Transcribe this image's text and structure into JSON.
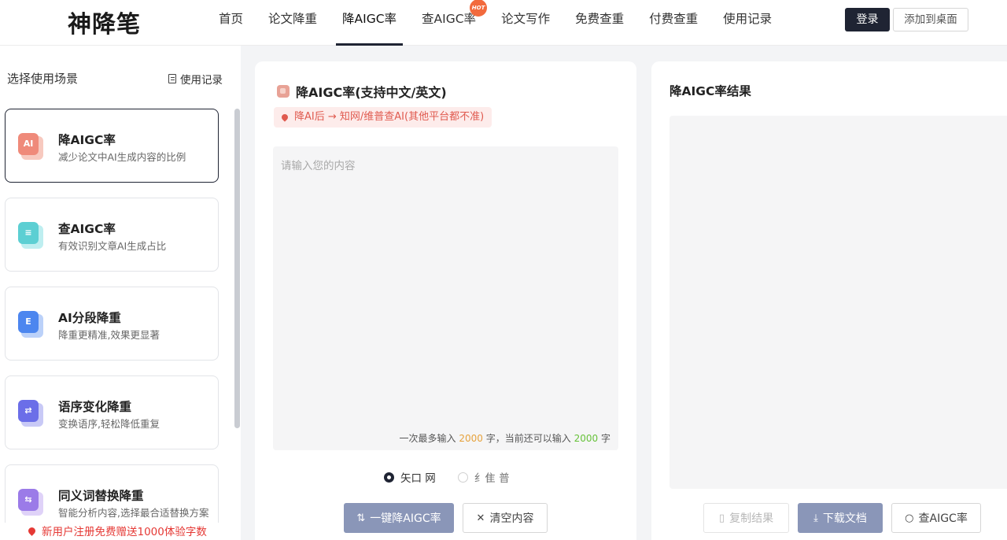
{
  "header": {
    "logo": "神降笔",
    "nav": [
      {
        "label": "首页",
        "active": false
      },
      {
        "label": "论文降重",
        "active": false
      },
      {
        "label": "降AIGC率",
        "active": true
      },
      {
        "label": "查AIGC率",
        "active": false,
        "badge": "HOT"
      },
      {
        "label": "论文写作",
        "active": false
      },
      {
        "label": "免费查重",
        "active": false
      },
      {
        "label": "付费查重",
        "active": false
      },
      {
        "label": "使用记录",
        "active": false
      }
    ],
    "login": "登录",
    "add_desktop": "添加到桌面"
  },
  "sidebar": {
    "title": "选择使用场景",
    "record_link": "使用记录",
    "cards": [
      {
        "title": "降AIGC率",
        "desc": "减少论文中AI生成内容的比例",
        "icon": "ai-reduce-icon",
        "color": "#ef8a7a",
        "active": true
      },
      {
        "title": "查AIGC率",
        "desc": "有效识别文章AI生成占比",
        "icon": "ai-detect-icon",
        "color": "#5ccfd3",
        "active": false
      },
      {
        "title": "AI分段降重",
        "desc": "降重更精准,效果更显著",
        "icon": "paragraph-icon",
        "color": "#4c86ef",
        "active": false
      },
      {
        "title": "语序变化降重",
        "desc": "变换语序,轻松降低重复",
        "icon": "reorder-icon",
        "color": "#6b6ee8",
        "active": false
      },
      {
        "title": "同义词替换降重",
        "desc": "智能分析内容,选择最合适替换方案",
        "icon": "synonym-icon",
        "color": "#9b7be8",
        "active": false
      }
    ],
    "promo": "新用户注册免费赠送1000体验字数"
  },
  "input_panel": {
    "title": "降AIGC率(支持中文/英文)",
    "tip": "降AI后 → 知网/维普查AI(其他平台都不准)",
    "placeholder": "请输入您的内容",
    "counter_prefix": "一次最多输入",
    "max_chars": "2000",
    "counter_mid": "字，当前还可以输入",
    "remaining_chars": "2000",
    "counter_suffix": "字",
    "radio_options": [
      {
        "label": "矢口 网",
        "checked": true
      },
      {
        "label": "纟隹 普",
        "checked": false
      }
    ],
    "submit_button": "一键降AIGC率",
    "clear_button": "清空内容"
  },
  "result_panel": {
    "title": "降AIGC率结果",
    "copy_button": "复制结果",
    "download_button": "下载文档",
    "check_button": "查AIGC率"
  }
}
